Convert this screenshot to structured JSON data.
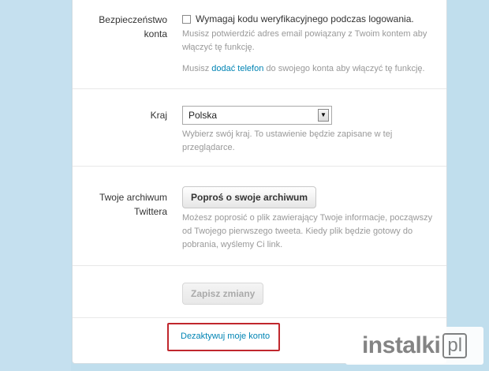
{
  "security": {
    "label": "Bezpieczeństwo konta",
    "checkbox_label": "Wymagaj kodu weryfikacyjnego podczas logowania.",
    "checked": false,
    "help1": "Musisz potwierdzić adres email powiązany z Twoim kontem aby włączyć tę funkcję.",
    "help2_pre": "Musisz ",
    "help2_link": "dodać telefon",
    "help2_post": " do swojego konta aby włączyć tę funkcję."
  },
  "country": {
    "label": "Kraj",
    "selected": "Polska",
    "help": "Wybierz swój kraj. To ustawienie będzie zapisane w tej przeglądarce."
  },
  "archive": {
    "label": "Twoje archiwum Twittera",
    "button": "Poproś o swoje archiwum",
    "help": "Możesz poprosić o plik zawierający Twoje informacje, począwszy od Twojego pierwszego tweeta. Kiedy plik będzie gotowy do pobrania, wyślemy Ci link."
  },
  "save": {
    "button": "Zapisz zmiany",
    "disabled": true
  },
  "deactivate": {
    "link": "Dezaktywuj moje konto"
  },
  "watermark": {
    "text": "instalki",
    "suffix": "pl"
  },
  "colors": {
    "link": "#0084b4",
    "highlight": "#c0272d",
    "background": "#c0deed"
  }
}
